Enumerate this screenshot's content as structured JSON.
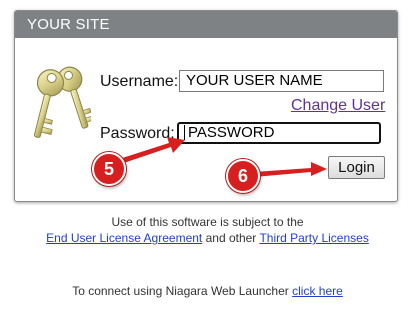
{
  "header": {
    "title": "YOUR SITE"
  },
  "form": {
    "username_label": "Username:",
    "username_value": "YOUR USER NAME",
    "change_user_link": "Change User",
    "password_label": "Password:",
    "password_value": "PASSWORD",
    "login_button": "Login"
  },
  "annotations": {
    "step_password": "5",
    "step_login": "6",
    "accent_color": "#d81f1f"
  },
  "footer": {
    "license_notice": "Use of this software is subject to the",
    "eula_link": "End User License Agreement",
    "and_other": "and other",
    "third_party_link": "Third Party Licenses",
    "launcher_text": "To connect using Niagara Web Launcher",
    "click_here_link": "click here"
  }
}
